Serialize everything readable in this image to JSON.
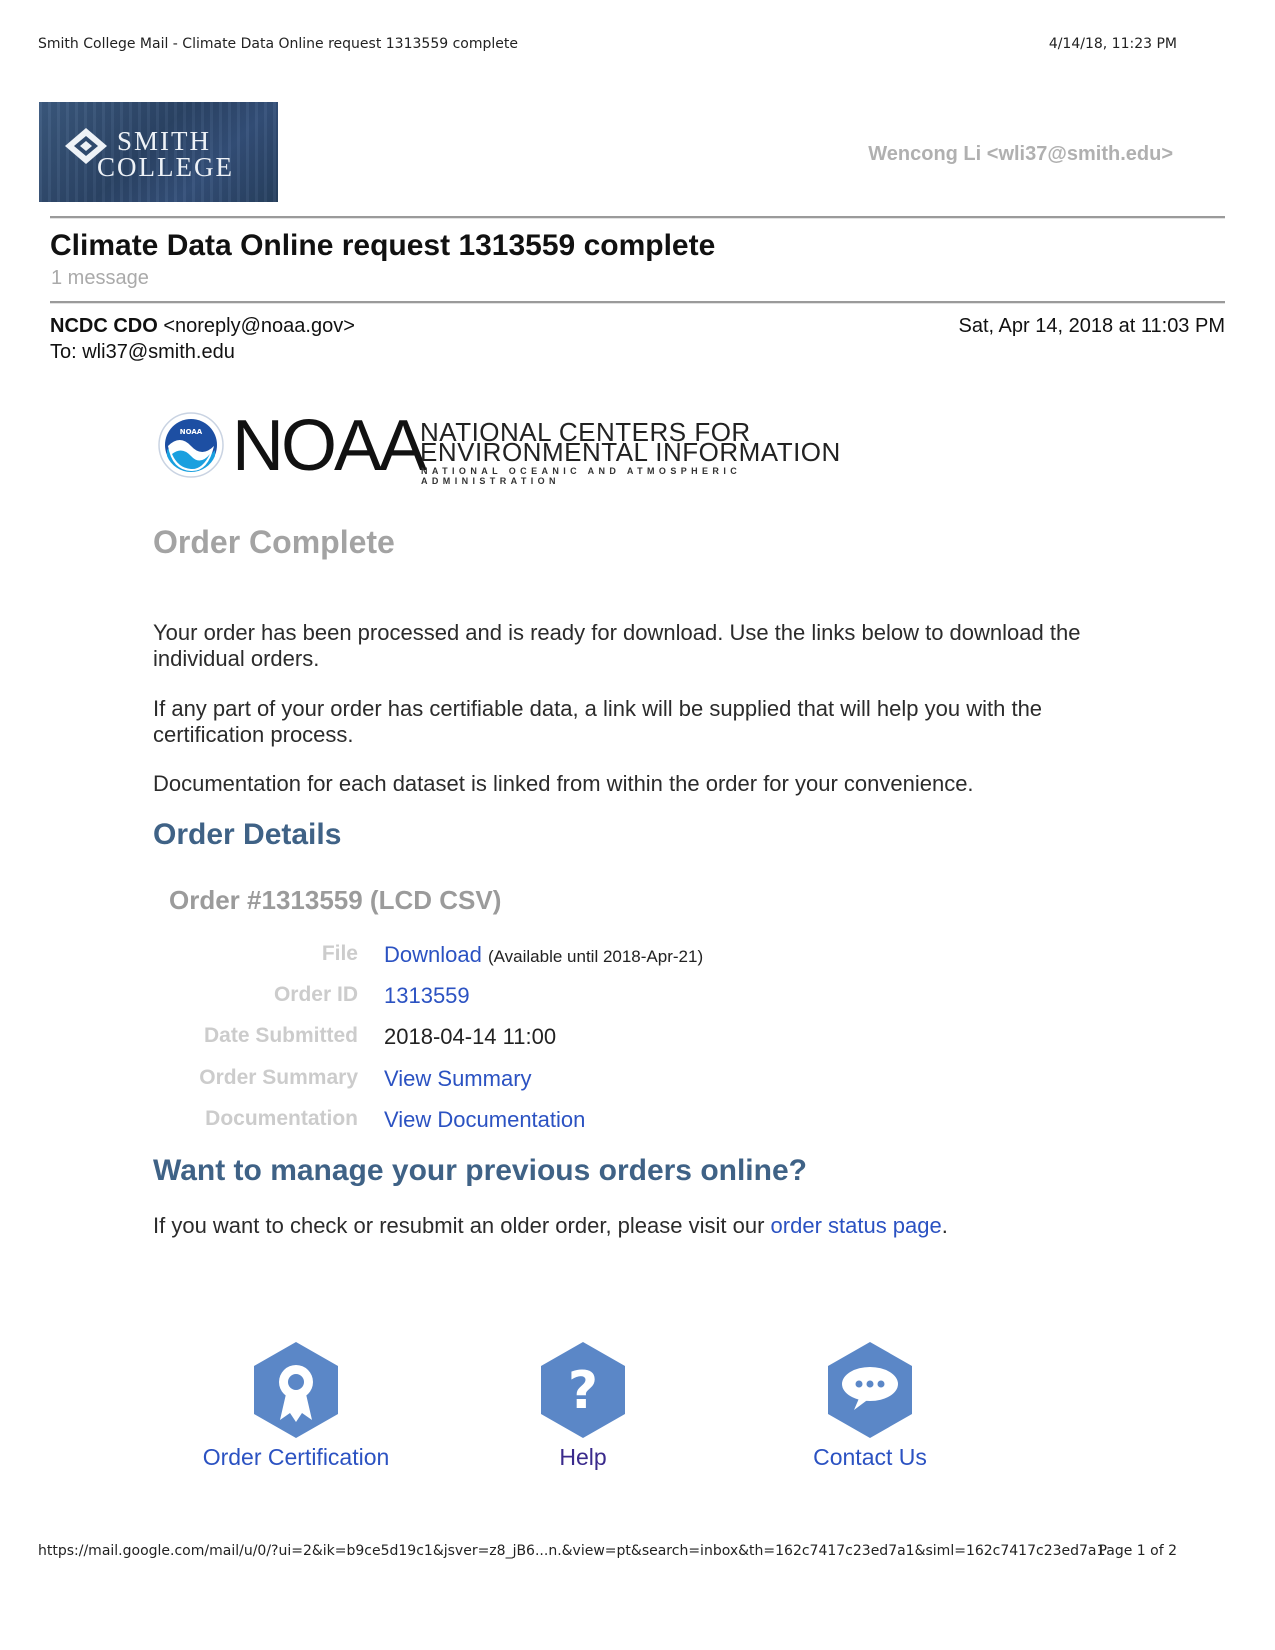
{
  "print_header": {
    "title": "Smith College Mail - Climate Data Online request 1313559 complete",
    "datetime": "4/14/18, 11:23 PM"
  },
  "logo": {
    "line1": "SMITH",
    "line2": "COLLEGE"
  },
  "account": "Wencong Li <wli37@smith.edu>",
  "email": {
    "subject": "Climate Data Online request 1313559 complete",
    "message_count": "1 message",
    "sender_name": "NCDC CDO",
    "sender_email": "<noreply@noaa.gov>",
    "recipient": "To: wli37@smith.edu",
    "date": "Sat, Apr 14, 2018 at 11:03 PM"
  },
  "noaa": {
    "wordmark": "NOAA",
    "line1": "NATIONAL CENTERS FOR",
    "line2": "ENVIRONMENTAL INFORMATION",
    "line3": "NATIONAL OCEANIC AND ATMOSPHERIC ADMINISTRATION",
    "seal_text": "NOAA"
  },
  "body": {
    "heading": "Order Complete",
    "para1": "Your order has been processed and is ready for download. Use the links below to download the individual orders.",
    "para2": "If any part of your order has certifiable data, a link will be supplied that will help you with the certification process.",
    "para3": "Documentation for each dataset is linked from within the order for your convenience.",
    "details_heading": "Order Details",
    "order_title": "Order #1313559 (LCD CSV)",
    "rows": {
      "file_label": "File",
      "file_link": "Download",
      "file_note": "(Available until 2018-Apr-21)",
      "id_label": "Order ID",
      "id_value": "1313559",
      "date_label": "Date Submitted",
      "date_value": "2018-04-14 11:00",
      "summary_label": "Order Summary",
      "summary_link": "View Summary",
      "doc_label": "Documentation",
      "doc_link": "View Documentation"
    },
    "manage_heading": "Want to manage your previous orders online?",
    "manage_text": "If you want to check or resubmit an older order, please visit our ",
    "manage_link": "order status page",
    "manage_end": "."
  },
  "footer_links": {
    "certification": "Order Certification",
    "help": "Help",
    "help_glyph": "?",
    "contact": "Contact Us"
  },
  "print_footer": {
    "url": "https://mail.google.com/mail/u/0/?ui=2&ik=b9ce5d19c1&jsver=z8_jB6...n.&view=pt&search=inbox&th=162c7417c23ed7a1&siml=162c7417c23ed7a1",
    "page": "Page 1 of 2"
  },
  "colors": {
    "heading_blue": "#3f6286",
    "link_blue": "#2b52c2",
    "icon_blue": "#5b87c7",
    "muted_gray": "#a3a3a3"
  }
}
